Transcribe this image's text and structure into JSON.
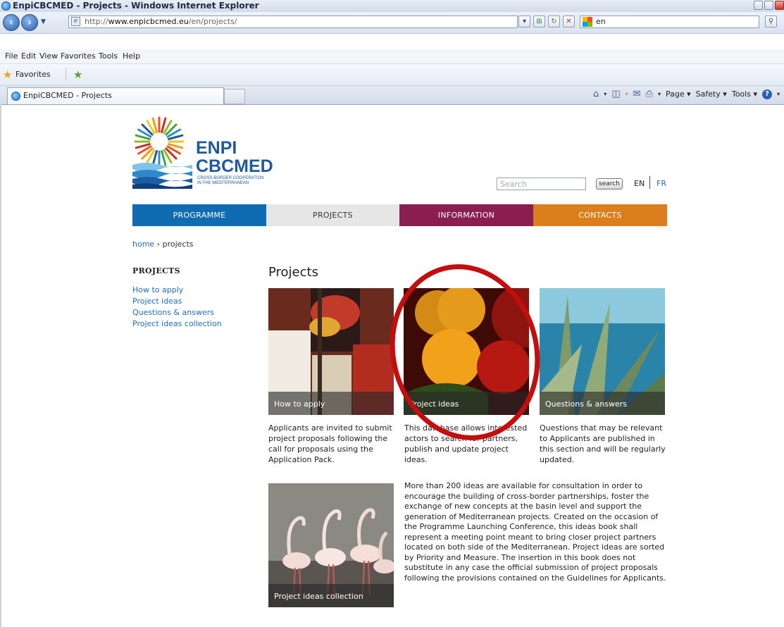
{
  "browser": {
    "window_title": "EnpiCBCMED - Projects - Windows Internet Explorer",
    "url_host": "www.enpicbcmed.eu",
    "url_prefix": "http://",
    "url_path": "/en/projects/",
    "live_search_value": "en",
    "menu": [
      "File",
      "Edit",
      "View",
      "Favorites",
      "Tools",
      "Help"
    ],
    "favorites_label": "Favorites",
    "tab_label": "EnpiCBCMED - Projects",
    "command_bar": [
      "Page",
      "Safety",
      "Tools"
    ]
  },
  "site": {
    "logo": {
      "line1": "ENPI",
      "line2": "CBCMED",
      "sub1": "CROSS-BORDER COOPERATION",
      "sub2": "IN THE MEDITERRANEAN"
    },
    "search": {
      "placeholder": "Search",
      "button": "search"
    },
    "languages": {
      "current": "EN",
      "other": "FR"
    },
    "nav": {
      "programme": "PROGRAMME",
      "projects": "PROJECTS",
      "information": "INFORMATION",
      "contacts": "CONTACTS"
    },
    "breadcrumb": {
      "home": "home",
      "sep": " › ",
      "current": "projects"
    },
    "sidebar": {
      "title": "PROJECTS",
      "links": [
        "How to apply",
        "Project ideas",
        "Questions & answers",
        "Project ideas collection"
      ]
    },
    "page_title": "Projects",
    "tiles": [
      {
        "caption": "How to apply",
        "text": "Applicants are invited to submit project proposals following the call for proposals using the Application Pack."
      },
      {
        "caption": "Project ideas",
        "text": "This database allows interested actors to search for partners, publish and update project ideas."
      },
      {
        "caption": "Questions & answers",
        "text": "Questions that may be relevant to Applicants are published in this section and will be regularly updated."
      },
      {
        "caption": "Project ideas collection",
        "text": "More than 200 ideas are available for consultation in order to encourage the building of cross-border partnerships, foster the exchange of new concepts at the basin level and support the generation of Mediterranean projects. Created on the occasion of the Programme Launching Conference, this ideas book shall represent a meeting point meant to bring closer project partners located on both side of the Mediterranean. Project ideas are sorted by Priority and Measure. The insertion in this book does not substitute in any case the official submission of project proposals following the provisions contained on the Guidelines for Applicants."
      }
    ]
  },
  "colors": {
    "programme": "#0f6cb2",
    "projects": "#e6e6e6",
    "information": "#8b1e50",
    "contacts": "#dd7e1c",
    "annotation": "#c40d0d",
    "link": "#1f6ec2"
  },
  "annotation": {
    "shape": "ellipse",
    "highlights": "Project ideas"
  }
}
